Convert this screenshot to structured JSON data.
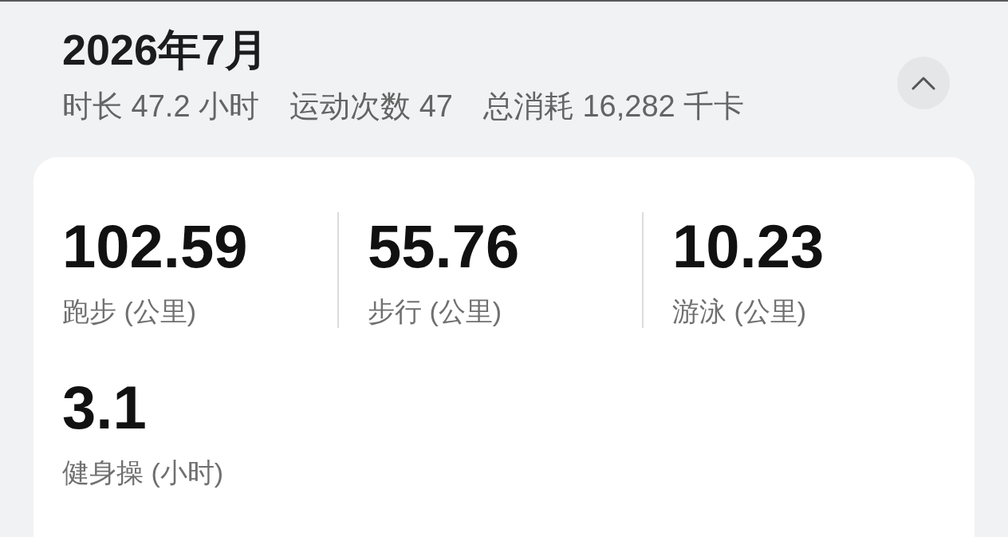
{
  "header": {
    "title": "2026年7月",
    "summary": [
      "时长 47.2 小时",
      "运动次数 47",
      "总消耗 16,282 千卡"
    ]
  },
  "collapse_button": {
    "expanded": true
  },
  "stats": [
    {
      "value": "102.59",
      "label": "跑步 (公里)"
    },
    {
      "value": "55.76",
      "label": "步行 (公里)"
    },
    {
      "value": "10.23",
      "label": "游泳 (公里)"
    },
    {
      "value": "3.1",
      "label": "健身操 (小时)"
    }
  ]
}
